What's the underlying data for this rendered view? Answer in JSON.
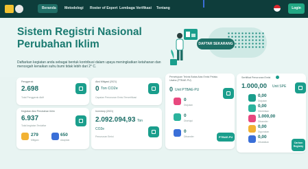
{
  "nav": {
    "links": [
      "Beranda",
      "Metodologi",
      "Roster of Expert",
      "Lembaga Verifikasi",
      "Tentang"
    ],
    "login": "Login"
  },
  "hero": {
    "title_line1": "Sistem Registri Nasional",
    "title_line2": "Perubahan Iklim",
    "subtitle": "Daftarkan kegiatan anda sebagai bentuk kontribusi dalam upaya meningkatkan ketahanan dan mencegah kenaikan suhu bumi tidak lebih dari 2° C.",
    "cta": "DAFTAR SEKARANG"
  },
  "cards": {
    "penggerak": {
      "label": "Penggerak",
      "value": "2.698",
      "sub": "Total Penggerak Aktif"
    },
    "aksi_mitigasi": {
      "label": "Aksi Mitigasi (2021)",
      "value": "0",
      "unit": "Ton CO2e",
      "sub": "Capaian Penurunan Emisi Terverifikasi"
    },
    "kegiatan": {
      "label": "Kegiatan Aksi Perubahan Iklim",
      "value": "6.937",
      "sub": "Total kegiatan Terdaftar",
      "items": [
        {
          "value": "279",
          "label": "Mitigasi"
        },
        {
          "value": "650",
          "label": "Adaptasi"
        }
      ]
    },
    "inventory": {
      "label": "Inventory (2021)",
      "value": "2.092.094,93",
      "unit": "Ton",
      "unit2": "CO2e",
      "sub": "Penurunan Emisi"
    },
    "ptbae": {
      "label": "Persetujuan Teknis Batas Atas Emisi Pelaku Usaha (PTBAE-PU)",
      "value": "0",
      "unit": "Unit PTBAE-PU",
      "items": [
        {
          "value": "0",
          "label": "Diajukan"
        },
        {
          "value": "0",
          "label": "Disetujui"
        },
        {
          "value": "0",
          "label": "Ditransfer"
        }
      ],
      "button": "PTBAE-PU"
    },
    "spe": {
      "label": "Sertifikat Penurunan Emisi",
      "value": "1.000,00",
      "unit": "Unit SPE",
      "items": [
        {
          "value": "0,00",
          "label": "Diajukan"
        },
        {
          "value": "0,00",
          "label": "Diterbitkan"
        },
        {
          "value": "1.000,00",
          "label": "Ditransfer"
        },
        {
          "value": "0,00",
          "label": "Digunakan"
        },
        {
          "value": "0,00",
          "label": "Dibatalkan"
        }
      ],
      "button": "Carbon Registry"
    }
  },
  "colors": {
    "nav_bg": "#0e3d3b",
    "accent": "#1a9e8c",
    "login": "#22a884",
    "title": "#1a7a70"
  }
}
